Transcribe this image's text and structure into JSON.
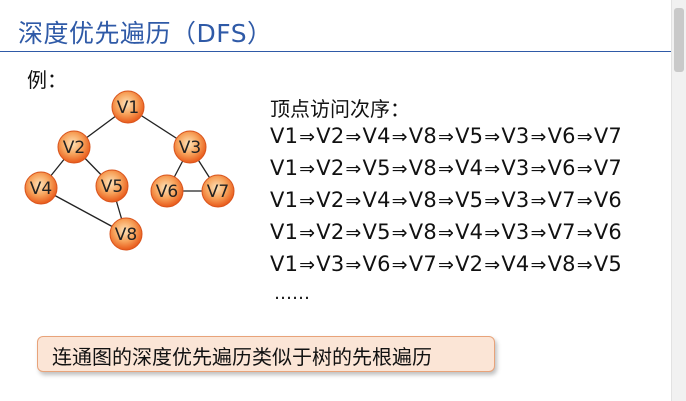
{
  "title": "深度优先遍历（DFS）",
  "example_label": "例：",
  "order_label": "顶点访问次序：",
  "sequences": [
    [
      "V1",
      "V2",
      "V4",
      "V8",
      "V5",
      "V3",
      "V6",
      "V7"
    ],
    [
      "V1",
      "V2",
      "V5",
      "V8",
      "V4",
      "V3",
      "V6",
      "V7"
    ],
    [
      "V1",
      "V2",
      "V4",
      "V8",
      "V5",
      "V3",
      "V7",
      "V6"
    ],
    [
      "V1",
      "V2",
      "V5",
      "V8",
      "V4",
      "V3",
      "V7",
      "V6"
    ],
    [
      "V1",
      "V3",
      "V6",
      "V7",
      "V2",
      "V4",
      "V8",
      "V5"
    ]
  ],
  "arrow": "⇒",
  "ellipsis": "……",
  "note": "连通图的深度优先遍历类似于树的先根遍历",
  "graph": {
    "nodes": [
      {
        "id": "V1",
        "label": "V1"
      },
      {
        "id": "V2",
        "label": "V2"
      },
      {
        "id": "V3",
        "label": "V3"
      },
      {
        "id": "V4",
        "label": "V4"
      },
      {
        "id": "V5",
        "label": "V5"
      },
      {
        "id": "V6",
        "label": "V6"
      },
      {
        "id": "V7",
        "label": "V7"
      },
      {
        "id": "V8",
        "label": "V8"
      }
    ],
    "edges": [
      [
        "V1",
        "V2"
      ],
      [
        "V1",
        "V3"
      ],
      [
        "V2",
        "V4"
      ],
      [
        "V2",
        "V5"
      ],
      [
        "V4",
        "V8"
      ],
      [
        "V5",
        "V8"
      ],
      [
        "V3",
        "V6"
      ],
      [
        "V3",
        "V7"
      ],
      [
        "V6",
        "V7"
      ]
    ]
  },
  "colors": {
    "title": "#2f5aa7",
    "node_fill_center": "#fcd4a0",
    "node_fill_edge": "#e8591a",
    "note_bg": "#fbe5d6"
  }
}
